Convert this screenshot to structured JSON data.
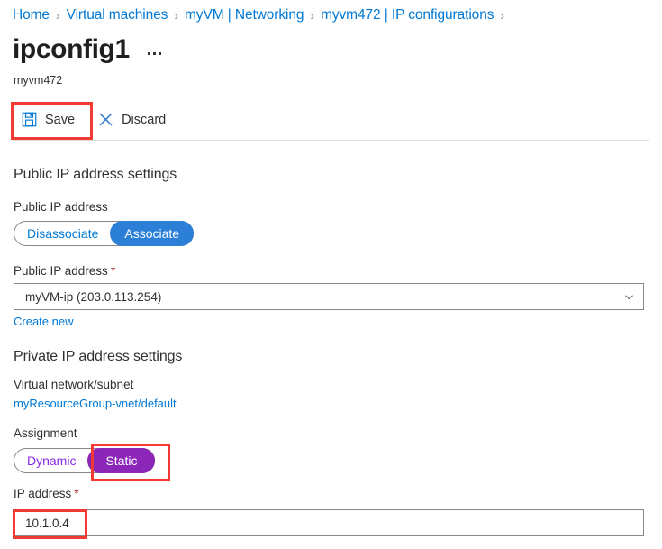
{
  "breadcrumb": {
    "separator": "›",
    "items": [
      {
        "label": "Home"
      },
      {
        "label": "Virtual machines"
      },
      {
        "label": "myVM | Networking"
      },
      {
        "label": "myvm472 | IP configurations"
      }
    ]
  },
  "header": {
    "title": "ipconfig1",
    "subtitle": "myvm472",
    "more_menu": "more-options"
  },
  "toolbar": {
    "save_label": "Save",
    "discard_label": "Discard",
    "save_icon": "save-floppy-icon",
    "discard_icon": "close-x-icon"
  },
  "public_ip_section": {
    "heading": "Public IP address settings",
    "toggle_label": "Public IP address",
    "toggle_options": [
      {
        "label": "Disassociate",
        "selected": false
      },
      {
        "label": "Associate",
        "selected": true
      }
    ],
    "dropdown_label": "Public IP address",
    "dropdown_required": "*",
    "dropdown_value": "myVM-ip (203.0.113.254)",
    "dropdown_icon": "chevron-down-icon",
    "create_new_link": "Create new"
  },
  "private_ip_section": {
    "heading": "Private IP address settings",
    "vnet_label": "Virtual network/subnet",
    "vnet_value": "myResourceGroup-vnet/default",
    "assignment_label": "Assignment",
    "assignment_options": [
      {
        "label": "Dynamic",
        "selected": false
      },
      {
        "label": "Static",
        "selected": true
      }
    ],
    "ip_label": "IP address",
    "ip_required": "*",
    "ip_value": "10.1.0.4",
    "ip_placeholder": ""
  },
  "annotations": [
    {
      "name": "save-button-highlight"
    },
    {
      "name": "static-toggle-highlight"
    },
    {
      "name": "ip-address-value-highlight"
    }
  ],
  "colors": {
    "accent_blue": "#0078d4",
    "toggle_blue": "#2c7fd6",
    "toggle_purple": "#8b26b8",
    "purple_text": "#8a2be2",
    "annotation_red": "#f13a33",
    "required_red": "#a4262c"
  }
}
